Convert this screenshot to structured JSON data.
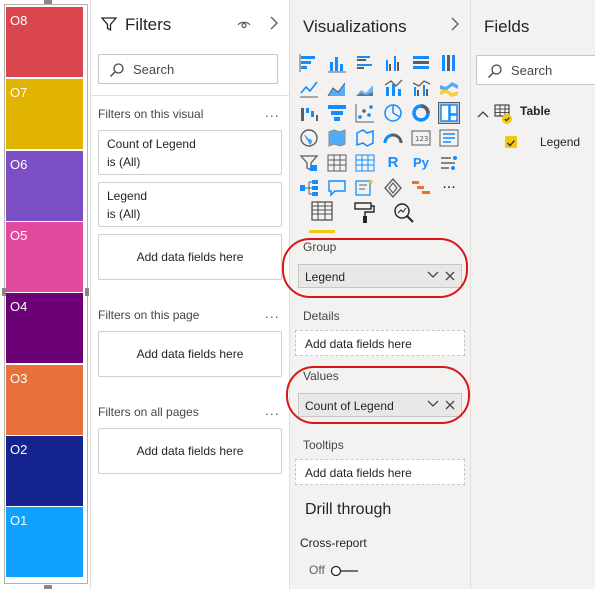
{
  "visual": {
    "blocks": [
      {
        "label": "O8",
        "color": "#d9464d"
      },
      {
        "label": "O7",
        "color": "#e0b400"
      },
      {
        "label": "O6",
        "color": "#7c4fc4"
      },
      {
        "label": "O5",
        "color": "#e04a9f"
      },
      {
        "label": "O4",
        "color": "#6b0077"
      },
      {
        "label": "O3",
        "color": "#e8703a"
      },
      {
        "label": "O2",
        "color": "#14238e"
      },
      {
        "label": "O1",
        "color": "#10a1ff"
      }
    ]
  },
  "filters": {
    "title": "Filters",
    "search_placeholder": "Search",
    "on_visual_label": "Filters on this visual",
    "cards": [
      {
        "line1": "Count of Legend",
        "line2": "is (All)"
      },
      {
        "line1": "Legend",
        "line2": "is (All)"
      }
    ],
    "add_fields": "Add data fields here",
    "on_page_label": "Filters on this page",
    "on_all_pages_label": "Filters on all pages",
    "dots": "..."
  },
  "visualizations": {
    "title": "Visualizations",
    "group_label": "Group",
    "group_value": "Legend",
    "details_label": "Details",
    "details_placeholder": "Add data fields here",
    "values_label": "Values",
    "values_value": "Count of Legend",
    "tooltips_label": "Tooltips",
    "tooltips_placeholder": "Add data fields here",
    "drill_title": "Drill through",
    "cross_report_label": "Cross-report",
    "toggle_state": "Off",
    "icon_more": "..."
  },
  "fields": {
    "title": "Fields",
    "search_placeholder": "Search",
    "table_name": "Table",
    "field_name": "Legend"
  },
  "colors": {
    "accent_yellow": "#f2c811",
    "annotation_red": "#d81818",
    "pane_bg": "#f3f2f1"
  }
}
